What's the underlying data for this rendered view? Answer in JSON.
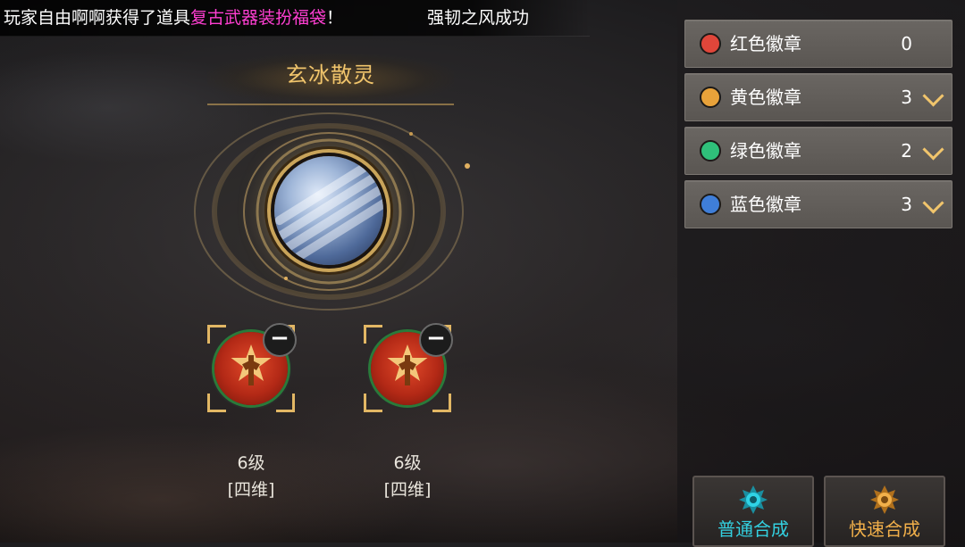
{
  "announcement": {
    "prefix": "玩家自由啊啊获得了道具",
    "item": "复古武器装扮福袋",
    "suffix": "！",
    "second": "强韧之风成功"
  },
  "synthesis": {
    "title": "玄冰散灵",
    "slots": [
      {
        "level": "6级",
        "type": "[四维]"
      },
      {
        "level": "6级",
        "type": "[四维]"
      }
    ]
  },
  "badges": [
    {
      "label": "红色徽章",
      "count": "0",
      "color": "#e0463a",
      "expandable": false
    },
    {
      "label": "黄色徽章",
      "count": "3",
      "color": "#e8a23a",
      "expandable": true
    },
    {
      "label": "绿色徽章",
      "count": "2",
      "color": "#2fc07a",
      "expandable": true
    },
    {
      "label": "蓝色徽章",
      "count": "3",
      "color": "#3f7ed8",
      "expandable": true
    }
  ],
  "buttons": {
    "normal": {
      "label": "普通合成",
      "color": "#33d0e0"
    },
    "quick": {
      "label": "快速合成",
      "color": "#f2b04a"
    }
  }
}
